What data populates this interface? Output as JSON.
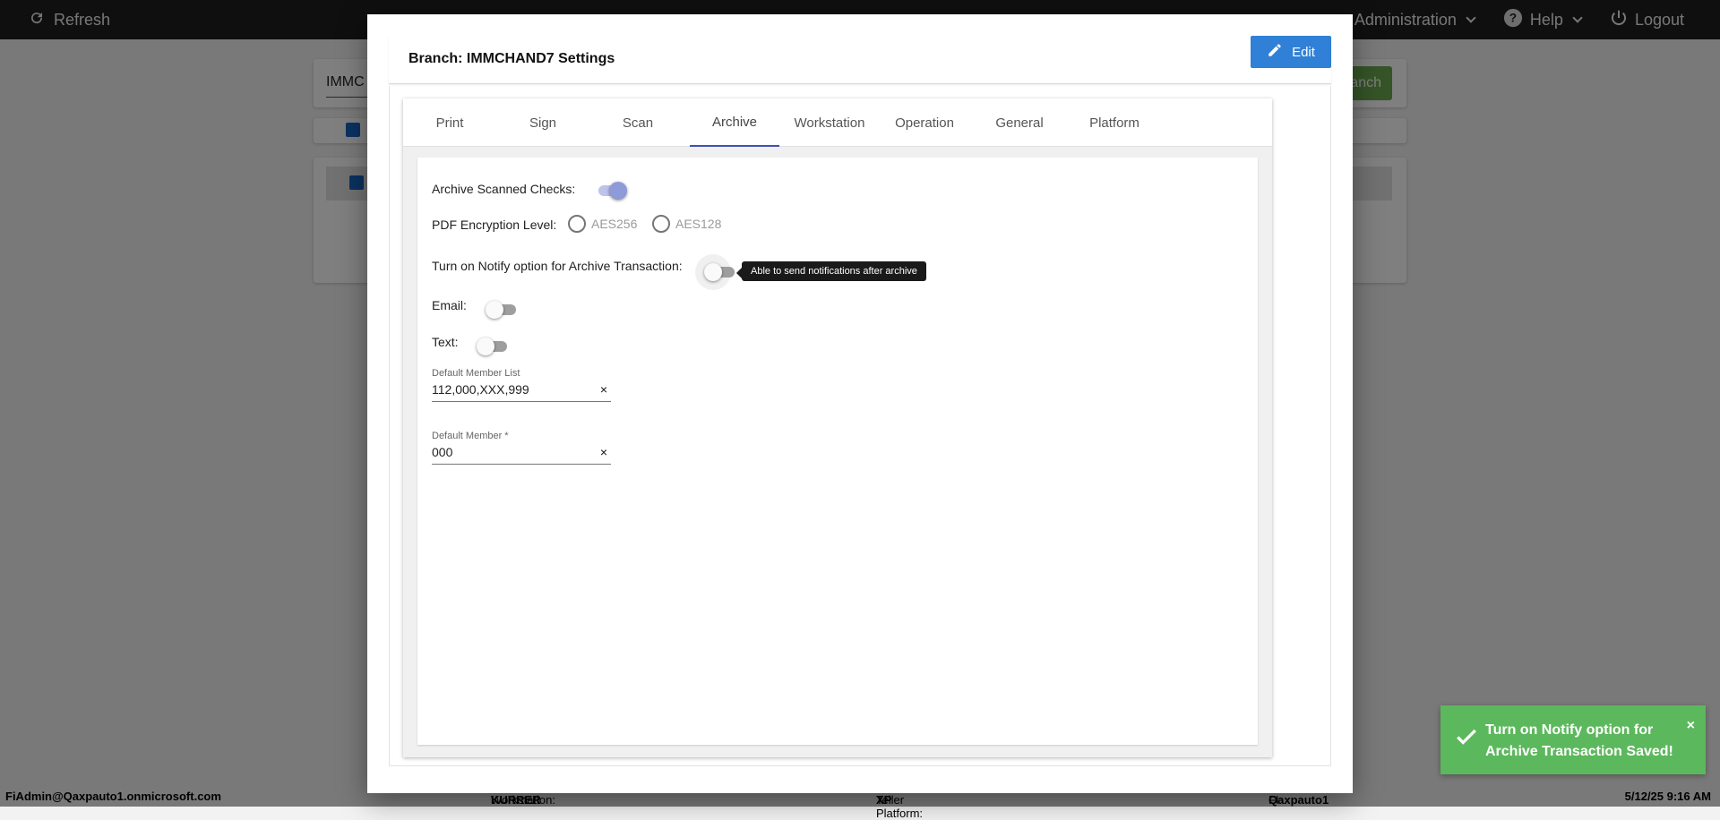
{
  "topbar": {
    "refresh_label": "Refresh",
    "administration_label": "Administration",
    "help_label": "Help",
    "logout_label": "Logout"
  },
  "background": {
    "search_text": "IMMC",
    "green_button_text": "anch"
  },
  "statusbar": {
    "user": "FiAdmin@Qaxpauto1.onmicrosoft.com",
    "workstation_label": "Workstation:",
    "workstation_value": "KURRER",
    "teller_platform_label": "Teller Platform:",
    "teller_platform_value": "XP",
    "fi_label": "FI:",
    "fi_value": "Qaxpauto1",
    "datetime": "5/12/25 9:16 AM"
  },
  "modal": {
    "title": "Branch: IMMCHAND7 Settings",
    "edit_label": "Edit",
    "tabs": [
      {
        "label": "Print"
      },
      {
        "label": "Sign"
      },
      {
        "label": "Scan"
      },
      {
        "label": "Archive",
        "active": true
      },
      {
        "label": "Workstation"
      },
      {
        "label": "Operation"
      },
      {
        "label": "General"
      },
      {
        "label": "Platform"
      }
    ],
    "archive": {
      "archive_scanned_checks_label": "Archive Scanned Checks:",
      "archive_scanned_checks_on": true,
      "pdf_encryption_label": "PDF Encryption Level:",
      "pdf_options": [
        "AES256",
        "AES128"
      ],
      "notify_label": "Turn on Notify option for Archive Transaction:",
      "notify_on": false,
      "notify_tooltip": "Able to send notifications after archive",
      "email_label": "Email:",
      "email_on": false,
      "text_label": "Text:",
      "text_on": false,
      "default_member_list_label": "Default Member List",
      "default_member_list_value": "112,000,XXX,999",
      "default_member_label": "Default Member *",
      "default_member_value": "000",
      "clear_glyph": "×"
    }
  },
  "toast": {
    "message": "Turn on Notify option for Archive Transaction Saved!",
    "close_glyph": "×",
    "color": "#5cb85c"
  },
  "colors": {
    "accent": "#3f51b5",
    "edit_button": "#2f80d6",
    "topbar": "#1f1f1f"
  }
}
